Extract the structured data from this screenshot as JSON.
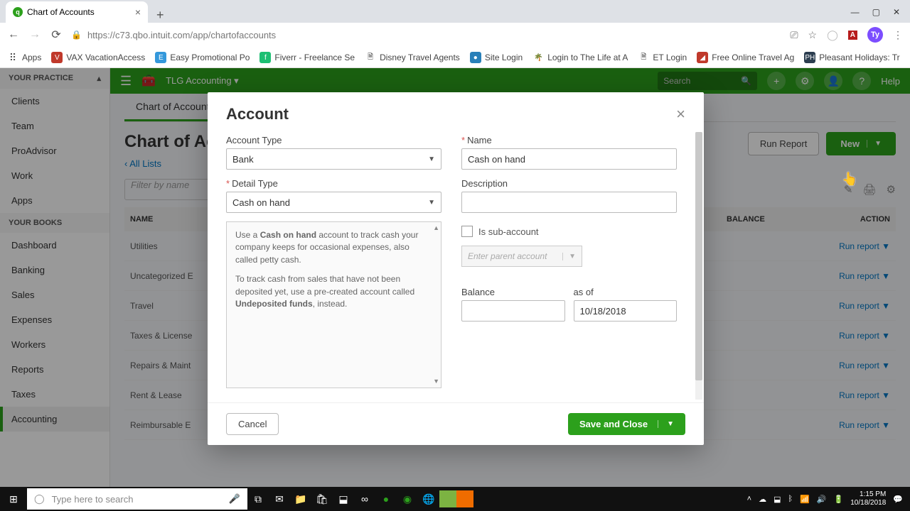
{
  "browser": {
    "tab_title": "Chart of Accounts",
    "url": "https://c73.qbo.intuit.com/app/chartofaccounts",
    "bookmarks": [
      {
        "label": "Apps",
        "color": "#888"
      },
      {
        "label": "VAX VacationAccess",
        "color": "#c0392b"
      },
      {
        "label": "Easy Promotional Po",
        "color": "#3498db"
      },
      {
        "label": "Fiverr - Freelance Se",
        "color": "#1dbf73"
      },
      {
        "label": "Disney Travel Agents",
        "color": "#666"
      },
      {
        "label": "Site Login",
        "color": "#2980b9"
      },
      {
        "label": "Login to The Life at A",
        "color": "#f39c12"
      },
      {
        "label": "ET Login",
        "color": "#666"
      },
      {
        "label": "Free Online Travel Ag",
        "color": "#c0392b"
      },
      {
        "label": "Pleasant Holidays: Tr",
        "color": "#2c3e50"
      }
    ]
  },
  "header": {
    "company": "TLG Accounting",
    "search_placeholder": "Search",
    "help": "Help"
  },
  "sidebar": {
    "your_practice": "YOUR PRACTICE",
    "practice_items": [
      "Clients",
      "Team",
      "ProAdvisor",
      "Work",
      "Apps"
    ],
    "your_books": "YOUR BOOKS",
    "books_items": [
      "Dashboard",
      "Banking",
      "Sales",
      "Expenses",
      "Workers",
      "Reports",
      "Taxes",
      "Accounting"
    ]
  },
  "page": {
    "tab": "Chart of Accounts",
    "title": "Chart of Accounts",
    "all_lists": "All Lists",
    "run_report": "Run Report",
    "new_btn": "New",
    "filter_placeholder": "Filter by name",
    "col_name": "NAME",
    "col_balance": "BALANCE",
    "col_action": "ACTION",
    "run_report_link": "Run report",
    "rows": [
      "Utilities",
      "Uncategorized E",
      "Travel",
      "Taxes & License",
      "Repairs & Maint",
      "Rent & Lease",
      "Reimbursable E"
    ]
  },
  "modal": {
    "title": "Account",
    "account_type_label": "Account Type",
    "account_type_value": "Bank",
    "detail_type_label": "Detail Type",
    "detail_type_value": "Cash on hand",
    "help_p1a": "Use a ",
    "help_p1b": "Cash on hand",
    "help_p1c": " account to track cash your company keeps for occasional expenses, also called petty cash.",
    "help_p2a": "To track cash from sales that have not been deposited yet, use a pre-created account called ",
    "help_p2b": "Undeposited funds",
    "help_p2c": ", instead.",
    "name_label": "Name",
    "name_value": "Cash on hand",
    "desc_label": "Description",
    "sub_label": "Is sub-account",
    "parent_placeholder": "Enter parent account",
    "balance_label": "Balance",
    "asof_label": "as of",
    "asof_value": "10/18/2018",
    "cancel": "Cancel",
    "save": "Save and Close"
  },
  "taskbar": {
    "search_placeholder": "Type here to search",
    "time": "1:15 PM",
    "date": "10/18/2018"
  }
}
